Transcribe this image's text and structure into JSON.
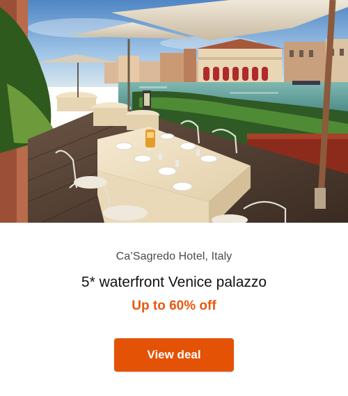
{
  "hero": {
    "image_alt": "Terrace restaurant tables with umbrellas beside the Grand Canal"
  },
  "deal": {
    "location": "Ca’Sagredo Hotel, Italy",
    "title": "5* waterfront Venice palazzo",
    "discount": "Up to 60% off",
    "cta_label": "View deal"
  },
  "colors": {
    "accent": "#e35205",
    "discount_text": "#e8590c",
    "title_text": "#111111",
    "location_text": "#4a4a4a"
  }
}
